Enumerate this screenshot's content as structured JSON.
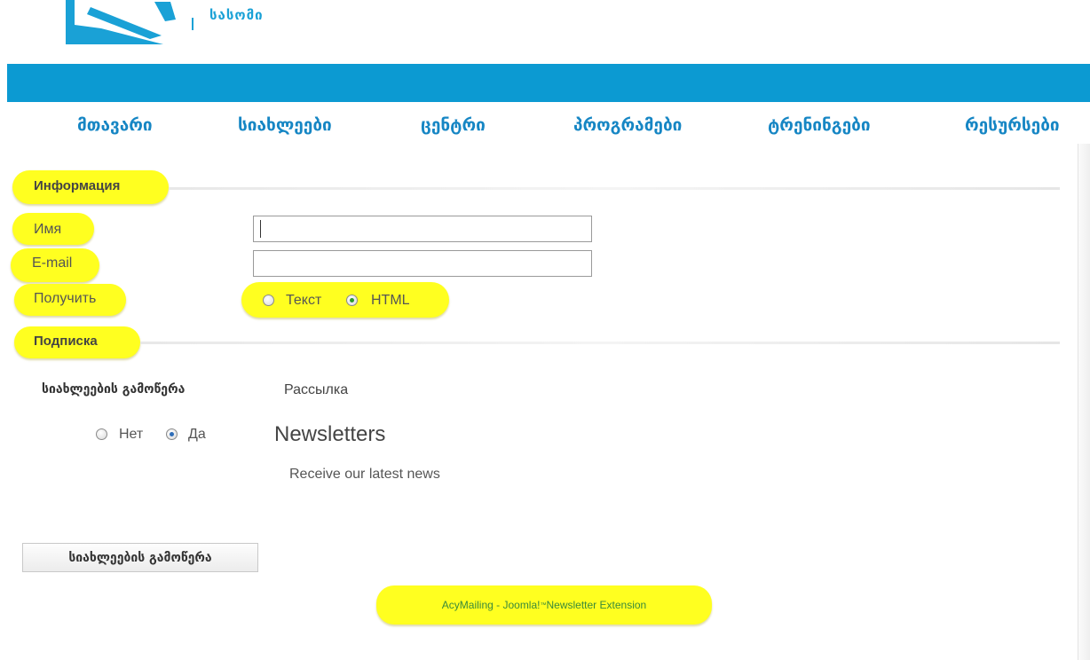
{
  "header": {
    "logo_text": "სასომი"
  },
  "nav": {
    "items": [
      {
        "label": "მთავარი"
      },
      {
        "label": "სიახლეები"
      },
      {
        "label": "ცენტრი"
      },
      {
        "label": "პროგრამები"
      },
      {
        "label": "ტრენინგები"
      },
      {
        "label": "რესურსები"
      }
    ]
  },
  "form": {
    "info_legend": "Информация",
    "name_label": "Имя",
    "name_value": "",
    "email_label": "E-mail",
    "email_value": "",
    "receive_label": "Получить",
    "format_options": [
      {
        "label": "Текст",
        "checked": false
      },
      {
        "label": "HTML",
        "checked": true
      }
    ],
    "subscription_legend": "Подписка",
    "subscribe_label": "სიახლეების გამოწერა",
    "subscribe_options": [
      {
        "label": "Нет",
        "checked": false
      },
      {
        "label": "Да",
        "checked": true
      }
    ],
    "list_header": "Рассылка",
    "list_name": "Newsletters",
    "list_description": "Receive our latest news",
    "submit_label": "სიახლეების გამოწერა"
  },
  "footer": {
    "link_text": "AcyMailing - Joomla!",
    "link_sup": "™",
    "link_suffix": " Newsletter Extension"
  },
  "colors": {
    "brand_blue": "#0c9ad2",
    "nav_text": "#1686c4",
    "highlight": "#ffff20",
    "footer_link": "#3a8a3a"
  }
}
